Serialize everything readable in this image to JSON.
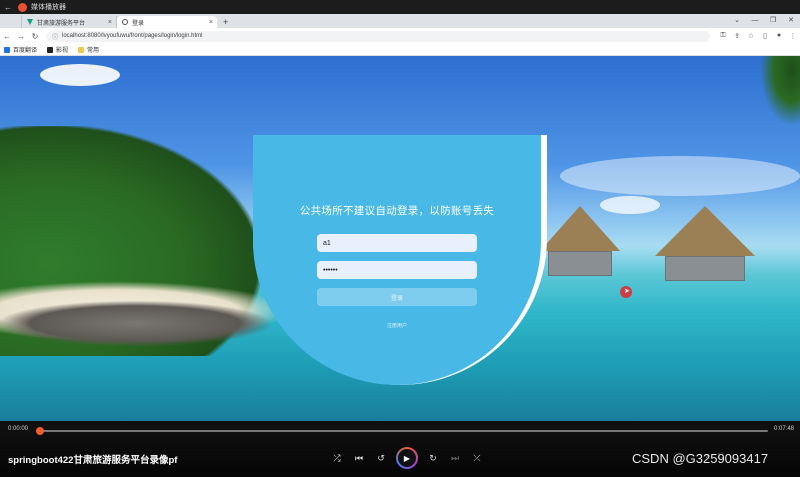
{
  "player": {
    "title": "媒体播放器",
    "back_icon": "arrow-left-icon"
  },
  "browser": {
    "tabs": [
      {
        "label": "",
        "active": false
      },
      {
        "label": "甘肃旅游服务平台",
        "active": false,
        "icon": "v-logo-icon",
        "close": "×"
      },
      {
        "label": "登录",
        "active": true,
        "icon": "globe-icon",
        "close": "×"
      }
    ],
    "newtab_label": "+",
    "window_controls": [
      "⌄",
      "—",
      "❐",
      "✕"
    ],
    "url": "localhost:8080/lvyoufuwu/front/pages/login/login.html",
    "bookmarks": [
      {
        "label": "百度翻译",
        "color": "#1a73e8"
      },
      {
        "label": "影视",
        "color": "#222222"
      },
      {
        "label": "常用",
        "color": "#f2c94c"
      }
    ]
  },
  "login": {
    "title": "公共场所不建议自动登录，以防账号丢失",
    "username_value": "a1",
    "password_value": "••••••",
    "login_button": "登录",
    "register_link": "注册用户"
  },
  "controls": {
    "current_time": "0:00:00",
    "total_time": "0:07:48",
    "progress_fraction": 0.0,
    "video_title": "springboot422甘肃旅游服务平台录像pf",
    "buttons": [
      "⤮",
      "⏮",
      "↺",
      "▶",
      "↻",
      "⏭",
      "⤫"
    ]
  },
  "watermark": "CSDN @G3259093417",
  "colors": {
    "card": "#48b8e6",
    "accent": "#f05f2a"
  }
}
